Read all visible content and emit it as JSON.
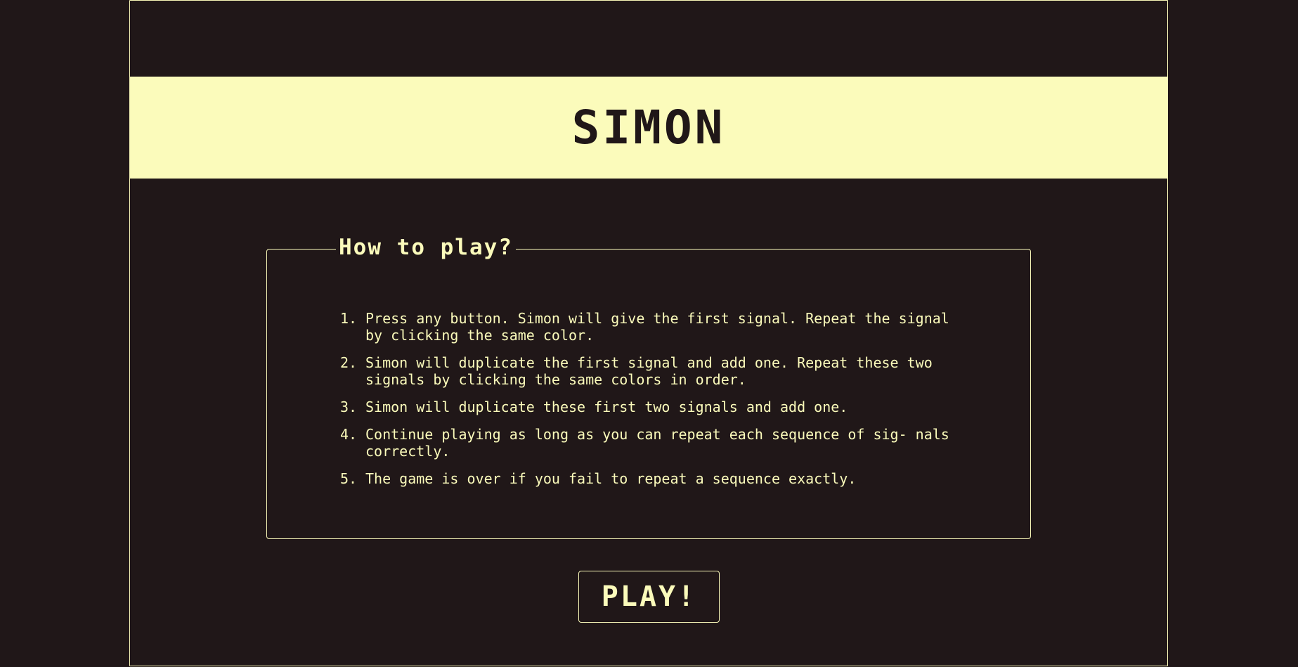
{
  "header": {
    "title": "SIMON"
  },
  "instructions": {
    "legend": "How to play?",
    "steps": [
      {
        "num": "1.",
        "text": "Press any button. Simon will give the first signal. Repeat the signal by clicking the same color."
      },
      {
        "num": "2.",
        "text": "Simon will duplicate the first signal and add one. Repeat these two signals by clicking the same colors in order."
      },
      {
        "num": "3.",
        "text": "Simon will duplicate these first two signals and add one."
      },
      {
        "num": "4.",
        "text": "Continue playing as long as you can repeat each sequence of sig- nals correctly."
      },
      {
        "num": "5.",
        "text": "The game is over if you fail to repeat a sequence exactly."
      }
    ]
  },
  "actions": {
    "play_label": "PLAY!"
  },
  "colors": {
    "background": "#201718",
    "accent": "#fbfbbb"
  }
}
